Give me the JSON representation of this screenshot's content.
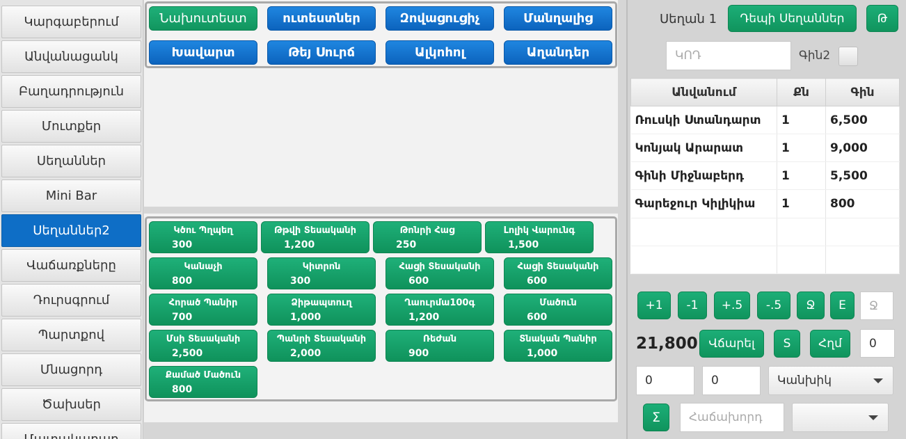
{
  "nav": {
    "items": [
      {
        "label": "Կարգաբերում",
        "active": false
      },
      {
        "label": "Անվանացանկ",
        "active": false
      },
      {
        "label": "Բաղադրություն",
        "active": false
      },
      {
        "label": "Մուտքեր",
        "active": false
      },
      {
        "label": "Սեղաններ",
        "active": false
      },
      {
        "label": "Mini Bar",
        "active": false
      },
      {
        "label": "Սեղաններ2",
        "active": true
      },
      {
        "label": "Վաճառքները",
        "active": false
      },
      {
        "label": "Դուրսգրում",
        "active": false
      },
      {
        "label": "Պարտքով",
        "active": false
      },
      {
        "label": "Մնացորդ",
        "active": false
      },
      {
        "label": "Ծախսեր",
        "active": false
      },
      {
        "label": "Մատակարար",
        "active": false
      }
    ]
  },
  "categories": [
    {
      "label": "Նախուտեստ"
    },
    {
      "label": "ուտեստներ"
    },
    {
      "label": "Զովացուցիչ"
    },
    {
      "label": "Մանղալից"
    },
    {
      "label": "Խավարտ"
    },
    {
      "label": "Թեյ Սուրճ"
    },
    {
      "label": "Ալկոհոլ"
    },
    {
      "label": "Աղանդեր"
    }
  ],
  "products": [
    {
      "name": "Կծու Պղպեղ",
      "price": "300"
    },
    {
      "name": "Թթվի Տեսականի",
      "price": "1,200"
    },
    {
      "name": "Թոնրի Հաց",
      "price": "250"
    },
    {
      "name": "Լոլիկ Վարունգ",
      "price": "1,500"
    },
    {
      "name": "Կանաչի",
      "price": "800"
    },
    {
      "name": "Կիտրոն",
      "price": "300"
    },
    {
      "name": "Հացի Տեսականի",
      "price": "600"
    },
    {
      "name": "Հացի Տեսականի",
      "price": "600"
    },
    {
      "name": "Հորած Պանիր",
      "price": "700"
    },
    {
      "name": "Ձիթապտուղ",
      "price": "1,000"
    },
    {
      "name": "Ղաուրմա100գ",
      "price": "1,200"
    },
    {
      "name": "Մածուն",
      "price": "600"
    },
    {
      "name": "Մսի Տեսականի",
      "price": "2,500"
    },
    {
      "name": "Պանրի Տեսականի",
      "price": "2,000"
    },
    {
      "name": "Ռեժան",
      "price": "900"
    },
    {
      "name": "Տնական Պանիր",
      "price": "1,000"
    },
    {
      "name": "Քամած Մածուն",
      "price": "800"
    }
  ],
  "order": {
    "table_label": "Սեղան 1",
    "to_tables_label": "Դեպի Սեղաններ",
    "t_button": "Թ",
    "code_placeholder": "ԿՈԴ",
    "price2_label": "Գին2",
    "columns": [
      "Անվանում",
      "Քն",
      "Գին"
    ],
    "rows": [
      {
        "name": "Ռուսկի Ստանդարտ",
        "qty": "1",
        "price": "6,500"
      },
      {
        "name": "Կոնյակ Արարատ",
        "qty": "1",
        "price": "9,000"
      },
      {
        "name": "Գինի Միջնաբերդ",
        "qty": "1",
        "price": "5,500"
      },
      {
        "name": "Գարեջուր Կիլիկիա",
        "qty": "1",
        "price": "800"
      }
    ]
  },
  "controls": {
    "plus1": "+1",
    "minus1": "-1",
    "plus_half": "+.5",
    "minus_half": "-.5",
    "q_button": "Ջ",
    "e_button": "E",
    "qty_placeholder": "Ջ",
    "total": "21,800",
    "pay_label": "Վճարել",
    "s_button": "S",
    "delete_label": "Հղմ",
    "discount_value": "0",
    "field1_value": "0",
    "field2_value": "0",
    "payment_type": "Կանխիկ",
    "sigma": "Σ",
    "customer_placeholder": "Հաճախորդ",
    "second_select": ""
  }
}
